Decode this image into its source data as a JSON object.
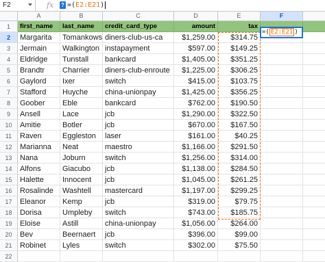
{
  "formula_bar": {
    "cell_ref": "F2",
    "fx_label": "fx",
    "help_chip": "?",
    "formula_prefix": "=(",
    "formula_range": "E2:E21",
    "formula_suffix": ")"
  },
  "column_headers": [
    "A",
    "B",
    "C",
    "D",
    "E",
    "F"
  ],
  "active_cell": {
    "ref": "F2",
    "prefix": "=(",
    "range": "E2:E21",
    "suffix": ")"
  },
  "table": {
    "headers": [
      "first_name",
      "last_name",
      "credit_card_type",
      "amount",
      "tax"
    ],
    "rows": [
      [
        "Margarita",
        "Tomankowski",
        "diners-club-us-ca",
        "$1,259.00",
        "$314.75"
      ],
      [
        "Jermain",
        "Walkington",
        "instapayment",
        "$597.00",
        "$149.25"
      ],
      [
        "Eldridge",
        "Tunstall",
        "bankcard",
        "$1,405.00",
        "$351.25"
      ],
      [
        "Brandtr",
        "Charrier",
        "diners-club-enroute",
        "$1,225.00",
        "$306.25"
      ],
      [
        "Gaylord",
        "Ixer",
        "switch",
        "$415.00",
        "$103.75"
      ],
      [
        "Stafford",
        "Huyche",
        "china-unionpay",
        "$1,425.00",
        "$356.25"
      ],
      [
        "Goober",
        "Eble",
        "bankcard",
        "$762.00",
        "$190.50"
      ],
      [
        "Ansell",
        "Lace",
        "jcb",
        "$1,290.00",
        "$322.50"
      ],
      [
        "Amitie",
        "Botler",
        "jcb",
        "$670.00",
        "$167.50"
      ],
      [
        "Raven",
        "Eggleston",
        "laser",
        "$161.00",
        "$40.25"
      ],
      [
        "Marianna",
        "Neat",
        "maestro",
        "$1,166.00",
        "$291.50"
      ],
      [
        "Nana",
        "Joburn",
        "switch",
        "$1,256.00",
        "$314.00"
      ],
      [
        "Alfons",
        "Giacubo",
        "jcb",
        "$1,138.00",
        "$284.50"
      ],
      [
        "Halette",
        "Innocent",
        "jcb",
        "$1,045.00",
        "$261.25"
      ],
      [
        "Rosalinde",
        "Washtell",
        "mastercard",
        "$1,197.00",
        "$299.25"
      ],
      [
        "Eleanor",
        "Kemp",
        "jcb",
        "$319.00",
        "$79.75"
      ],
      [
        "Dorisa",
        "Umpleby",
        "switch",
        "$743.00",
        "$185.75"
      ],
      [
        "Eloise",
        "Astill",
        "china-unionpay",
        "$1,056.00",
        "$264.00"
      ],
      [
        "Bev",
        "Beernaert",
        "jcb",
        "$396.00",
        "$99.00"
      ],
      [
        "Robinet",
        "Lyles",
        "switch",
        "$302.00",
        "$75.50"
      ]
    ]
  },
  "row_numbers": [
    "1",
    "2",
    "3",
    "4",
    "5",
    "6",
    "7",
    "8",
    "9",
    "10",
    "11",
    "12",
    "13",
    "14",
    "15",
    "16",
    "17",
    "18",
    "19",
    "20",
    "21",
    "22"
  ]
}
